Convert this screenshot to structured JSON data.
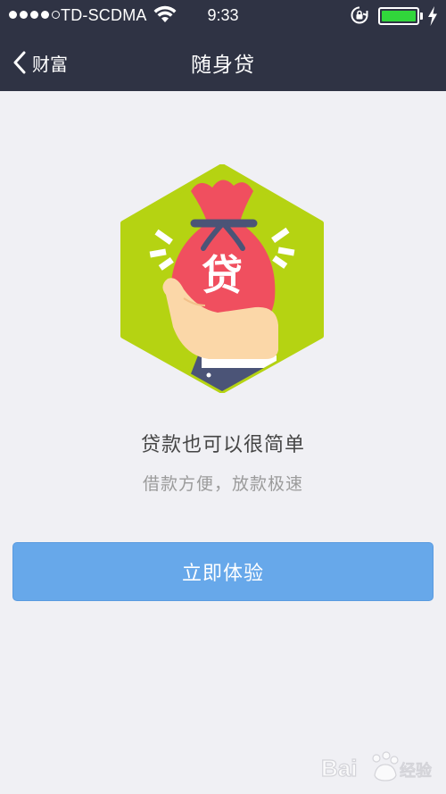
{
  "status_bar": {
    "carrier": "TD-SCDMA",
    "time": "9:33",
    "battery_level": 1.0
  },
  "nav": {
    "back_label": "财富",
    "title": "随身贷"
  },
  "illustration": {
    "badge_char": "贷"
  },
  "content": {
    "headline": "贷款也可以很简单",
    "subline": "借款方便，放款极速"
  },
  "cta": {
    "label": "立即体验"
  },
  "colors": {
    "topbar": "#2f3344",
    "background": "#f0f0f4",
    "accent_button": "#67a8ea",
    "hexagon": "#b5d312",
    "bag": "#f04f5f",
    "bag_tie": "#4b5477",
    "battery": "#31d63b"
  }
}
